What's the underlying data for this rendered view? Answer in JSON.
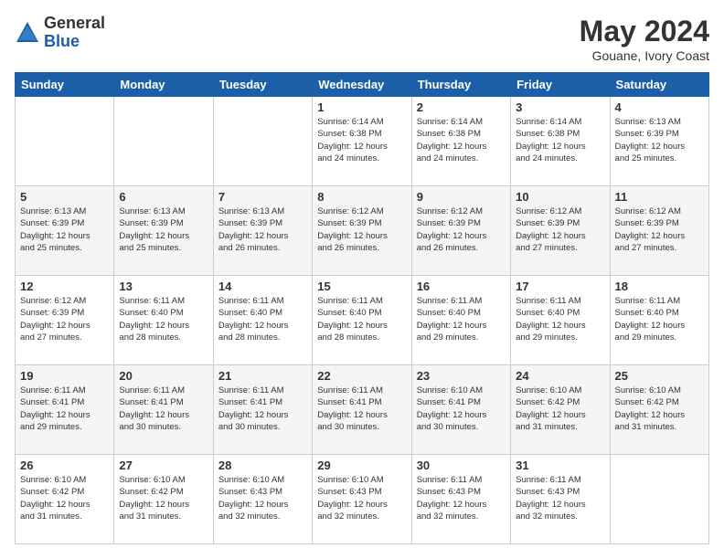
{
  "header": {
    "logo_general": "General",
    "logo_blue": "Blue",
    "title": "May 2024",
    "subtitle": "Gouane, Ivory Coast"
  },
  "days_of_week": [
    "Sunday",
    "Monday",
    "Tuesday",
    "Wednesday",
    "Thursday",
    "Friday",
    "Saturday"
  ],
  "weeks": [
    {
      "days": [
        {
          "number": "",
          "info": ""
        },
        {
          "number": "",
          "info": ""
        },
        {
          "number": "",
          "info": ""
        },
        {
          "number": "1",
          "info": "Sunrise: 6:14 AM\nSunset: 6:38 PM\nDaylight: 12 hours\nand 24 minutes."
        },
        {
          "number": "2",
          "info": "Sunrise: 6:14 AM\nSunset: 6:38 PM\nDaylight: 12 hours\nand 24 minutes."
        },
        {
          "number": "3",
          "info": "Sunrise: 6:14 AM\nSunset: 6:38 PM\nDaylight: 12 hours\nand 24 minutes."
        },
        {
          "number": "4",
          "info": "Sunrise: 6:13 AM\nSunset: 6:39 PM\nDaylight: 12 hours\nand 25 minutes."
        }
      ]
    },
    {
      "days": [
        {
          "number": "5",
          "info": "Sunrise: 6:13 AM\nSunset: 6:39 PM\nDaylight: 12 hours\nand 25 minutes."
        },
        {
          "number": "6",
          "info": "Sunrise: 6:13 AM\nSunset: 6:39 PM\nDaylight: 12 hours\nand 25 minutes."
        },
        {
          "number": "7",
          "info": "Sunrise: 6:13 AM\nSunset: 6:39 PM\nDaylight: 12 hours\nand 26 minutes."
        },
        {
          "number": "8",
          "info": "Sunrise: 6:12 AM\nSunset: 6:39 PM\nDaylight: 12 hours\nand 26 minutes."
        },
        {
          "number": "9",
          "info": "Sunrise: 6:12 AM\nSunset: 6:39 PM\nDaylight: 12 hours\nand 26 minutes."
        },
        {
          "number": "10",
          "info": "Sunrise: 6:12 AM\nSunset: 6:39 PM\nDaylight: 12 hours\nand 27 minutes."
        },
        {
          "number": "11",
          "info": "Sunrise: 6:12 AM\nSunset: 6:39 PM\nDaylight: 12 hours\nand 27 minutes."
        }
      ]
    },
    {
      "days": [
        {
          "number": "12",
          "info": "Sunrise: 6:12 AM\nSunset: 6:39 PM\nDaylight: 12 hours\nand 27 minutes."
        },
        {
          "number": "13",
          "info": "Sunrise: 6:11 AM\nSunset: 6:40 PM\nDaylight: 12 hours\nand 28 minutes."
        },
        {
          "number": "14",
          "info": "Sunrise: 6:11 AM\nSunset: 6:40 PM\nDaylight: 12 hours\nand 28 minutes."
        },
        {
          "number": "15",
          "info": "Sunrise: 6:11 AM\nSunset: 6:40 PM\nDaylight: 12 hours\nand 28 minutes."
        },
        {
          "number": "16",
          "info": "Sunrise: 6:11 AM\nSunset: 6:40 PM\nDaylight: 12 hours\nand 29 minutes."
        },
        {
          "number": "17",
          "info": "Sunrise: 6:11 AM\nSunset: 6:40 PM\nDaylight: 12 hours\nand 29 minutes."
        },
        {
          "number": "18",
          "info": "Sunrise: 6:11 AM\nSunset: 6:40 PM\nDaylight: 12 hours\nand 29 minutes."
        }
      ]
    },
    {
      "days": [
        {
          "number": "19",
          "info": "Sunrise: 6:11 AM\nSunset: 6:41 PM\nDaylight: 12 hours\nand 29 minutes."
        },
        {
          "number": "20",
          "info": "Sunrise: 6:11 AM\nSunset: 6:41 PM\nDaylight: 12 hours\nand 30 minutes."
        },
        {
          "number": "21",
          "info": "Sunrise: 6:11 AM\nSunset: 6:41 PM\nDaylight: 12 hours\nand 30 minutes."
        },
        {
          "number": "22",
          "info": "Sunrise: 6:11 AM\nSunset: 6:41 PM\nDaylight: 12 hours\nand 30 minutes."
        },
        {
          "number": "23",
          "info": "Sunrise: 6:10 AM\nSunset: 6:41 PM\nDaylight: 12 hours\nand 30 minutes."
        },
        {
          "number": "24",
          "info": "Sunrise: 6:10 AM\nSunset: 6:42 PM\nDaylight: 12 hours\nand 31 minutes."
        },
        {
          "number": "25",
          "info": "Sunrise: 6:10 AM\nSunset: 6:42 PM\nDaylight: 12 hours\nand 31 minutes."
        }
      ]
    },
    {
      "days": [
        {
          "number": "26",
          "info": "Sunrise: 6:10 AM\nSunset: 6:42 PM\nDaylight: 12 hours\nand 31 minutes."
        },
        {
          "number": "27",
          "info": "Sunrise: 6:10 AM\nSunset: 6:42 PM\nDaylight: 12 hours\nand 31 minutes."
        },
        {
          "number": "28",
          "info": "Sunrise: 6:10 AM\nSunset: 6:43 PM\nDaylight: 12 hours\nand 32 minutes."
        },
        {
          "number": "29",
          "info": "Sunrise: 6:10 AM\nSunset: 6:43 PM\nDaylight: 12 hours\nand 32 minutes."
        },
        {
          "number": "30",
          "info": "Sunrise: 6:11 AM\nSunset: 6:43 PM\nDaylight: 12 hours\nand 32 minutes."
        },
        {
          "number": "31",
          "info": "Sunrise: 6:11 AM\nSunset: 6:43 PM\nDaylight: 12 hours\nand 32 minutes."
        },
        {
          "number": "",
          "info": ""
        }
      ]
    }
  ]
}
